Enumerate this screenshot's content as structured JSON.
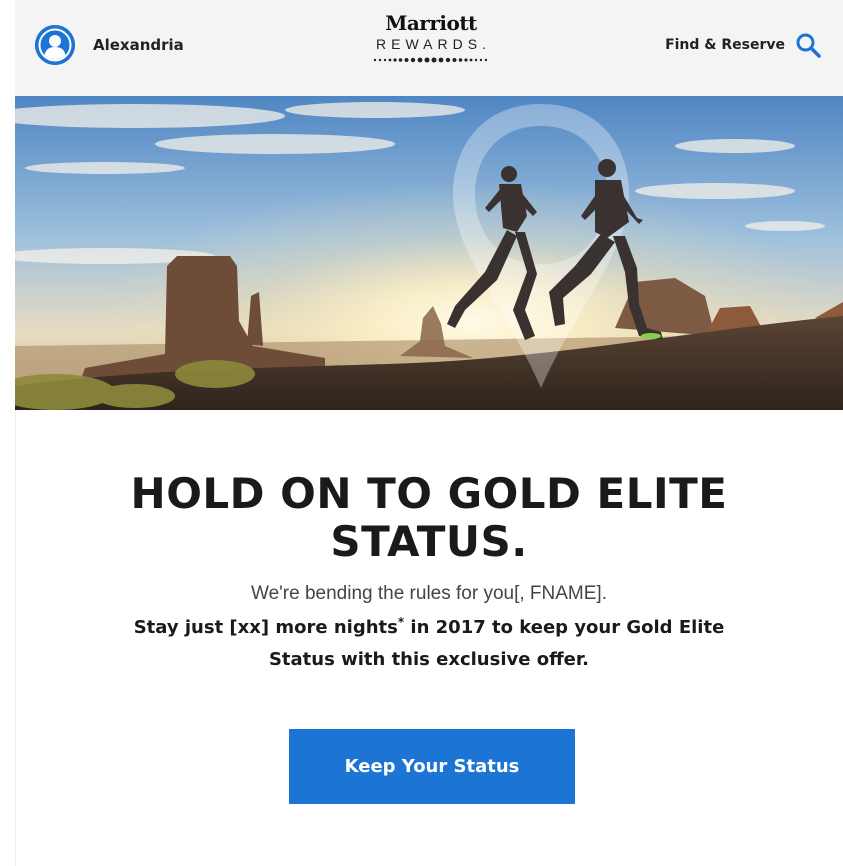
{
  "header": {
    "user_name": "Alexandria",
    "logo": {
      "brand": "Marriott",
      "tagline": "REWARDS."
    },
    "find_reserve_label": "Find & Reserve",
    "icons": {
      "avatar": "user-icon",
      "search": "search-icon"
    }
  },
  "hero": {
    "description_icon": "location-pin-icon"
  },
  "main": {
    "headline": "HOLD ON TO GOLD ELITE STATUS.",
    "greeting": "We're bending the rules for you[, FNAME].",
    "offer_prefix": "Stay just [xx] more nights",
    "offer_mark": "*",
    "offer_suffix": " in 2017 to keep your Gold Elite Status with this exclusive offer.",
    "cta_label": "Keep Your Status"
  },
  "colors": {
    "accent_blue": "#1c74d4",
    "header_bg": "#f4f4f4",
    "text_dark": "#1a1a1a"
  }
}
